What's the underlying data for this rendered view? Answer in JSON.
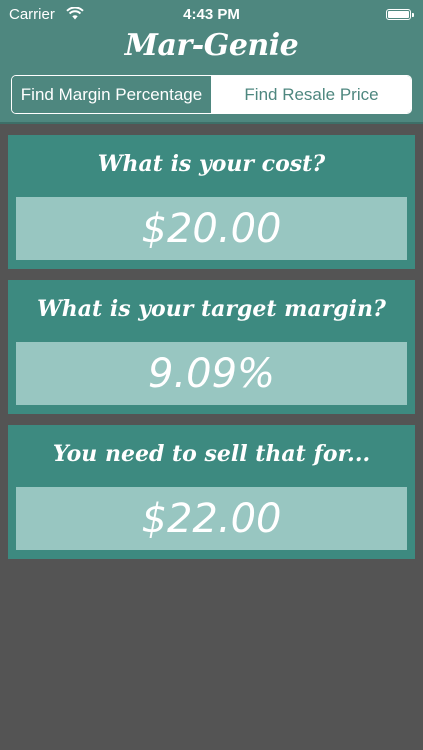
{
  "status_bar": {
    "carrier": "Carrier",
    "time": "4:43 PM",
    "battery_level": 1.0
  },
  "app": {
    "title": "Mar-Genie"
  },
  "mode_control": {
    "segments": [
      {
        "label": "Find Margin Percentage",
        "selected": false
      },
      {
        "label": "Find Resale Price",
        "selected": true
      }
    ]
  },
  "cards": [
    {
      "label": "What is your cost?",
      "value": "$20.00"
    },
    {
      "label": "What is your target margin?",
      "value": "9.09%"
    },
    {
      "label": "You need to sell that for...",
      "value": "$22.00"
    }
  ],
  "icons": {
    "wifi": "wifi-icon",
    "battery": "battery-icon"
  },
  "colors": {
    "header": "#4e877f",
    "card": "#3d8a80",
    "field": "#98c6c1",
    "background": "#545454"
  }
}
